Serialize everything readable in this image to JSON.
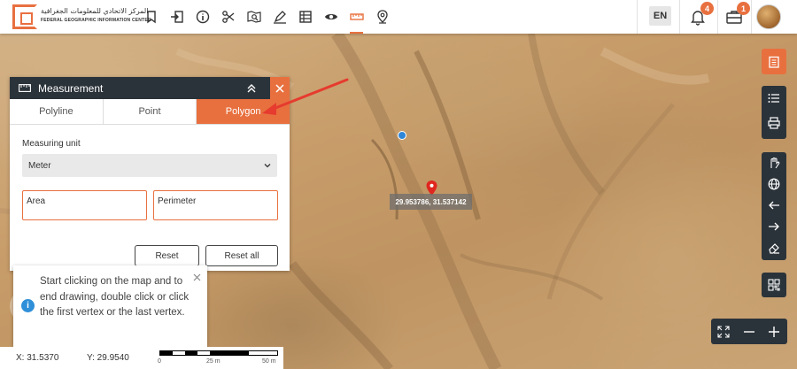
{
  "header": {
    "logo_ar": "المركز الاتحادي للمعلومات الجغرافية",
    "logo_en": "FEDERAL GEOGRAPHIC INFORMATION CENTER",
    "language": "EN",
    "notifications_count": "4",
    "messages_count": "1"
  },
  "toolbar": {
    "icons": [
      "bookmark-icon",
      "login-icon",
      "info-icon",
      "scissors-icon",
      "map-search-icon",
      "draw-icon",
      "table-icon",
      "eye-icon",
      "measure-icon",
      "location-pin-icon"
    ],
    "active": "measure-icon"
  },
  "measurement": {
    "title": "Measurement",
    "tabs": [
      "Polyline",
      "Point",
      "Polygon"
    ],
    "active_tab": "Polygon",
    "unit_label": "Measuring unit",
    "unit_value": "Meter",
    "area_label": "Area",
    "perimeter_label": "Perimeter",
    "reset_label": "Reset",
    "reset_all_label": "Reset all"
  },
  "tooltip": {
    "text": "Start clicking on the map and to end drawing, double click or click the first vertex or the last vertex."
  },
  "status": {
    "x": "X: 31.5370",
    "y": "Y: 29.9540"
  },
  "scale": {
    "labels": [
      "0",
      "25 m",
      "50 m"
    ]
  },
  "map": {
    "coordinate_readout": "29.953786, 31.537142"
  },
  "colors": {
    "accent": "#e8703f",
    "dark": "#2b333a",
    "marker": "#e0261f",
    "location": "#2e86d8"
  }
}
